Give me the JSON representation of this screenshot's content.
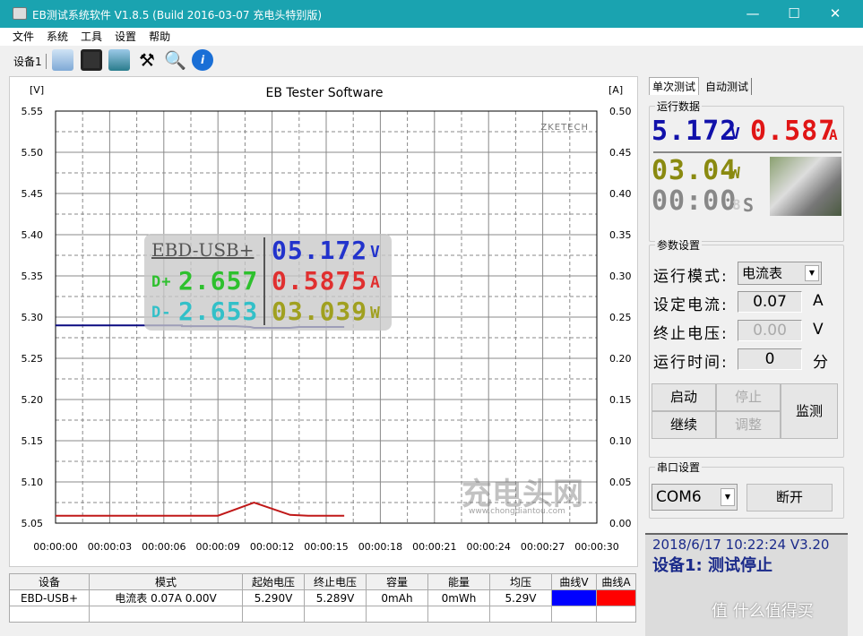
{
  "window": {
    "title": "EB测试系统软件 V1.8.5 (Build 2016-03-07 充电头特别版)",
    "minimize": "—",
    "maximize": "☐",
    "close": "✕"
  },
  "menu": [
    "文件",
    "系统",
    "工具",
    "设置",
    "帮助"
  ],
  "toolbar": {
    "device": "设备1",
    "icons": [
      "folder-icon",
      "save-icon",
      "picture-icon",
      "tools-icon",
      "magnifier-icon",
      "info-icon"
    ]
  },
  "chart_data": {
    "type": "line",
    "title": "EB Tester Software",
    "ylabel": "[V]",
    "y2label": "[A]",
    "watermark": "ZKETECH",
    "watermark2": "充电头网",
    "watermark2_url": "www.chongdiantou.com",
    "ylim": [
      5.05,
      5.55
    ],
    "y2lim": [
      0,
      0.5
    ],
    "xlim": [
      0,
      30
    ],
    "yticks": [
      "5.55",
      "5.50",
      "5.45",
      "5.40",
      "5.35",
      "5.30",
      "5.25",
      "5.20",
      "5.15",
      "5.10",
      "5.05"
    ],
    "y2ticks": [
      "0.50",
      "0.45",
      "0.40",
      "0.35",
      "0.30",
      "0.25",
      "0.20",
      "0.15",
      "0.10",
      "0.05",
      "0.00"
    ],
    "xticks": [
      "00:00:00",
      "00:00:03",
      "00:00:06",
      "00:00:09",
      "00:00:12",
      "00:00:15",
      "00:00:18",
      "00:00:21",
      "00:00:24",
      "00:00:27",
      "00:00:30"
    ],
    "grid": true,
    "series": [
      {
        "axis": "left",
        "color": "#0a0a80",
        "x": [
          0,
          7,
          7,
          10,
          10.8,
          11,
          13,
          13.5,
          16
        ],
        "y": [
          5.29,
          5.29,
          5.289,
          5.289,
          5.288,
          5.287,
          5.287,
          5.288,
          5.288
        ]
      },
      {
        "axis": "right",
        "color": "#c01818",
        "x": [
          0,
          9,
          11,
          13,
          14,
          16
        ],
        "y": [
          0.009,
          0.009,
          0.025,
          0.01,
          0.009,
          0.009
        ]
      }
    ]
  },
  "overlay": {
    "name": "EBD-USB+",
    "dp_label": "D+",
    "dp": "2.657",
    "dm_label": "D-",
    "dm": "2.653",
    "v": "05.172",
    "v_unit": "V",
    "a": "0.5875",
    "a_unit": "A",
    "w": "03.039",
    "w_unit": "W"
  },
  "tabs": [
    "单次测试",
    "自动测试"
  ],
  "run": {
    "legend": "运行数据",
    "voltage": "5.172",
    "v_unit": "V",
    "current": "0.587",
    "a_unit": "A",
    "power": "03.04",
    "w_unit": "W",
    "time": "00:00",
    "time_extra": "8",
    "s_unit": "S"
  },
  "params": {
    "legend": "参数设置",
    "mode_label": "运行模式:",
    "mode": "电流表",
    "current_label": "设定电流:",
    "current": "0.07",
    "current_unit": "A",
    "voltage_label": "终止电压:",
    "voltage": "0.00",
    "voltage_unit": "V",
    "time_label": "运行时间:",
    "time": "0",
    "time_unit": "分",
    "start": "启动",
    "stop": "停止",
    "continue": "继续",
    "adjust": "调整",
    "monitor": "监测"
  },
  "serial": {
    "legend": "串口设置",
    "port": "COM6",
    "disconnect": "断开"
  },
  "status": {
    "line1": "2018/6/17 10:22:24  V3.20",
    "line2": "设备1: 测试停止"
  },
  "table": {
    "headers": [
      "设备",
      "模式",
      "起始电压",
      "终止电压",
      "容量",
      "能量",
      "均压",
      "曲线V",
      "曲线A"
    ],
    "rows": [
      [
        "EBD-USB+",
        "电流表  0.07A  0.00V",
        "5.290V",
        "5.289V",
        "0mAh",
        "0mWh",
        "5.29V"
      ]
    ],
    "colors": {
      "v": "#0000ff",
      "a": "#ff0000"
    }
  },
  "corner_watermark": "值 什么值得买"
}
